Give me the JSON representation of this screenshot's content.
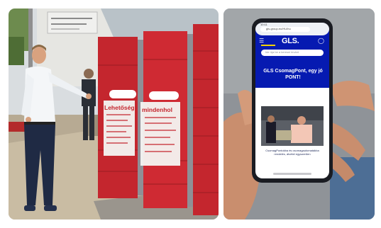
{
  "left_photo": {
    "locker_signs": [
      "Lehetőség",
      "mindenhol"
    ]
  },
  "right_photo": {
    "phone_screen": {
      "status_time": "10:11",
      "url": "gls-group.eu/HU/hu",
      "brand_logo": "GLS.",
      "search_placeholder": "Ide írja be a keresni kívánt",
      "headline": "GLS CsomagPont, egy jó PONT!",
      "caption": "CsomagPontokba és csomagautomatá­kba rendelés, átvétel egyszerűen"
    }
  },
  "colors": {
    "locker_red": "#c4262e",
    "gls_blue": "#061ab1",
    "gls_yellow": "#f5d100"
  }
}
